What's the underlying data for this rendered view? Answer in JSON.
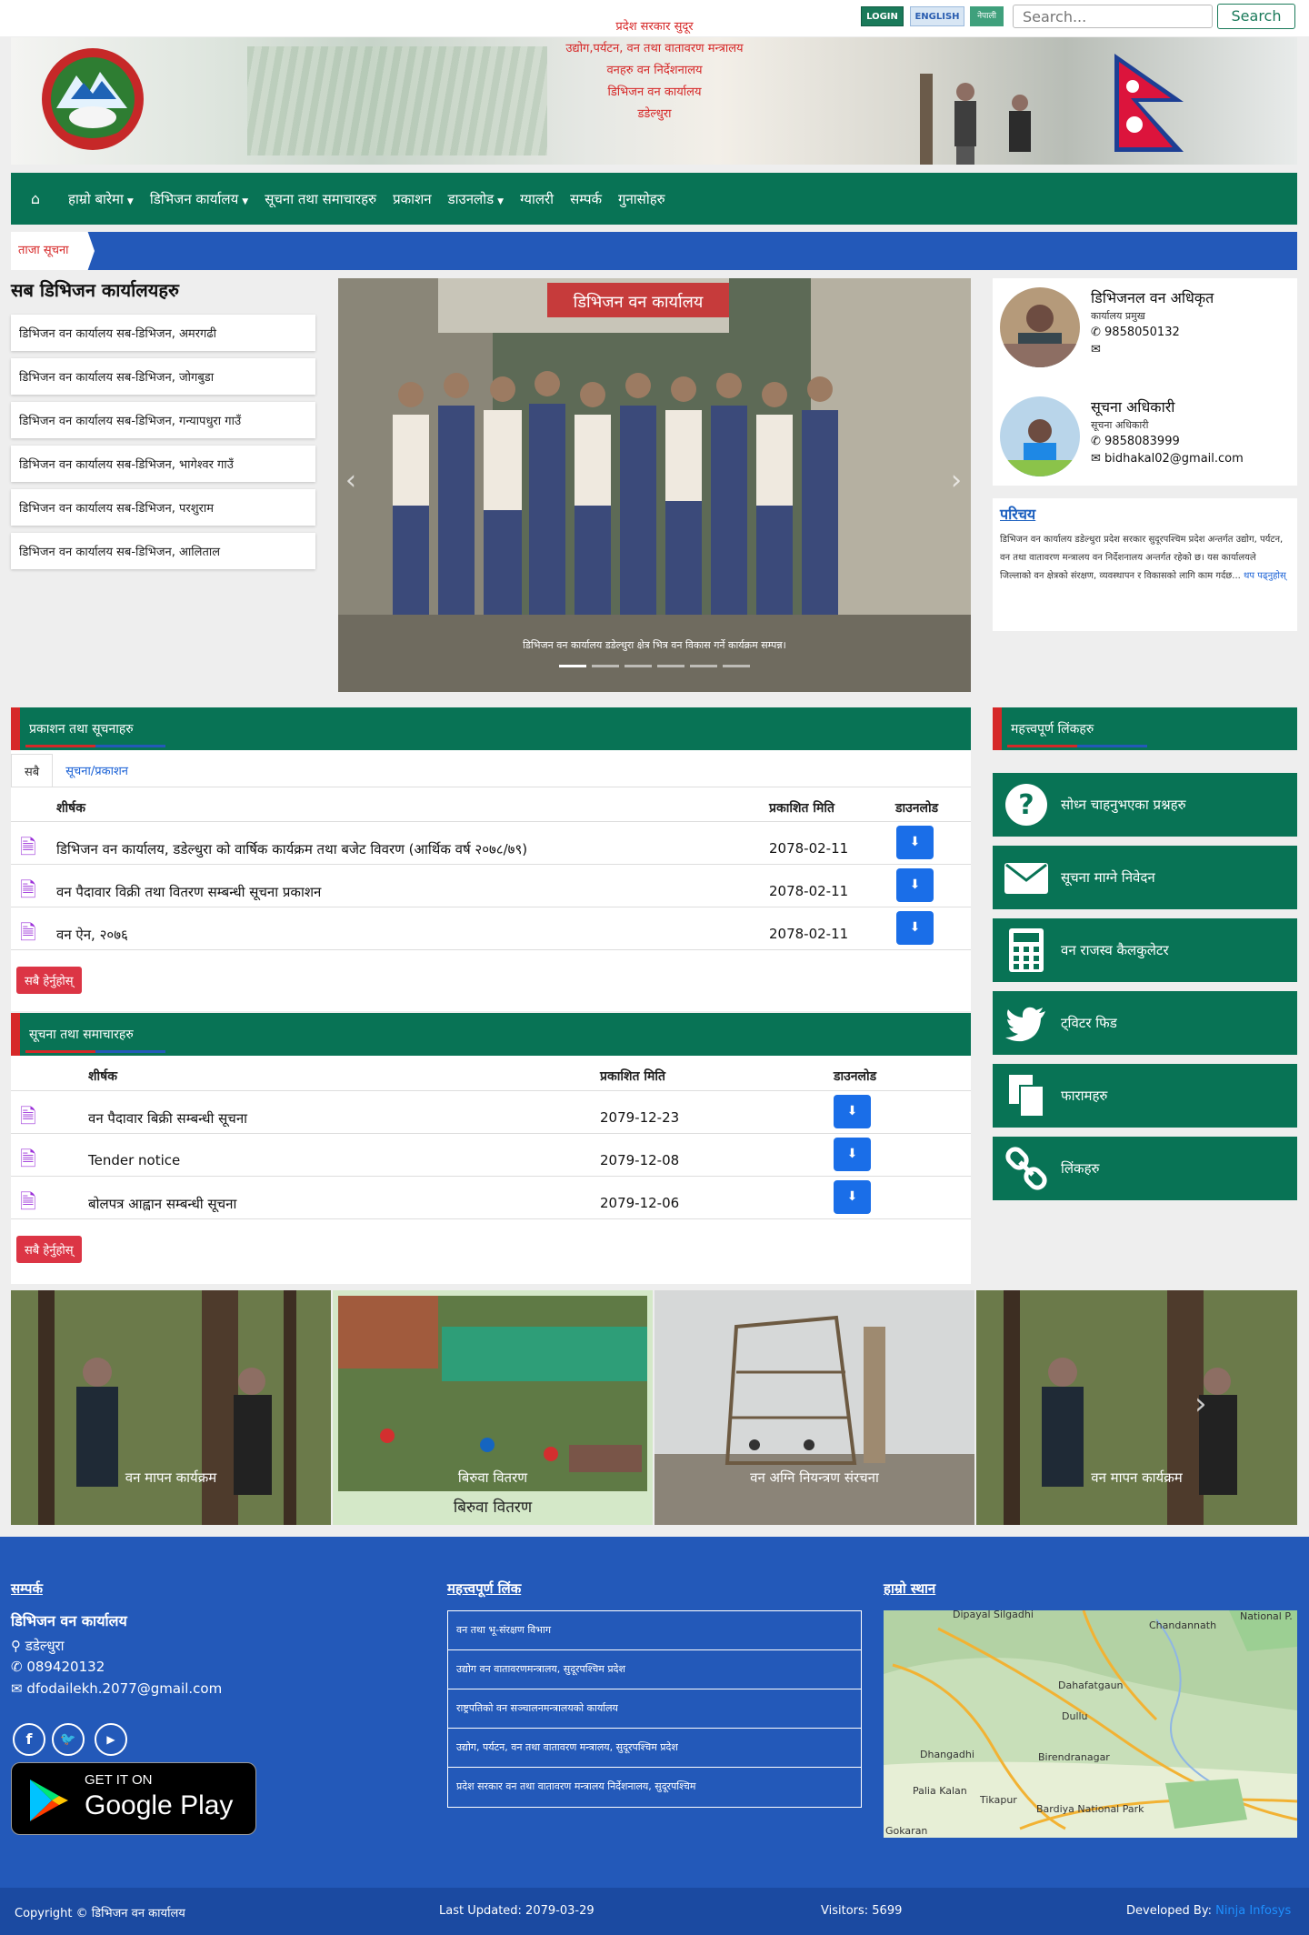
{
  "topbar": {
    "login_label": "LOGIN",
    "english_label": "ENGLISH",
    "nepali_label": "नेपाली",
    "search_placeholder": "Search...",
    "search_button": "Search"
  },
  "banner": {
    "lines": [
      "प्रदेश सरकार सुदूर",
      "उद्योग,पर्यटन, वन तथा वातावरण मन्त्रालय",
      "वनहरु वन निर्देशनालय",
      "डिभिजन वन कार्यालय",
      "डडेल्धुरा"
    ]
  },
  "nav": {
    "home_icon": "home-icon",
    "items": [
      {
        "label": "हाम्रो बारेमा",
        "dropdown": true
      },
      {
        "label": "डिभिजन कार्यालय",
        "dropdown": true
      },
      {
        "label": "सूचना तथा समाचारहरु",
        "dropdown": false
      },
      {
        "label": "प्रकाशन",
        "dropdown": false
      },
      {
        "label": "डाउनलोड",
        "dropdown": true
      },
      {
        "label": "ग्यालरी",
        "dropdown": false
      },
      {
        "label": "सम्पर्क",
        "dropdown": false
      },
      {
        "label": "गुनासोहरु",
        "dropdown": false
      }
    ]
  },
  "ticker": {
    "label": "ताजा सूचना"
  },
  "offices": {
    "title": "सब डिभिजन कार्यालयहरु",
    "items": [
      "डिभिजन वन कार्यालय सब-डिभिजन, अमरगढी",
      "डिभिजन वन कार्यालय सब-डिभिजन, जोगबुडा",
      "डिभिजन वन कार्यालय सब-डिभिजन, गन्यापधुरा गाउँ",
      "डिभिजन वन कार्यालय सब-डिभिजन, भागेश्वर गाउँ",
      "डिभिजन वन कार्यालय सब-डिभिजन, परशुराम",
      "डिभिजन वन कार्यालय सब-डिभिजन, आलिताल"
    ]
  },
  "carousel": {
    "caption": "डिभिजन वन कार्यालय डडेल्धुरा क्षेत्र भित्र वन विकास गर्ने कार्यक्रम सम्पन्न।",
    "slide_count": 6,
    "active_slide": 1,
    "sign_text": "डिभिजन वन कार्यालय"
  },
  "staff": [
    {
      "name": "डिभिजनल वन अधिकृत",
      "role": "कार्यालय प्रमुख",
      "phone": "9858050132",
      "email": ""
    },
    {
      "name": "सूचना अधिकारी",
      "role": "सूचना अधिकारी",
      "phone": "9858083999",
      "email": "bidhakal02@gmail.com"
    }
  ],
  "about": {
    "title": "परिचय",
    "body": "डिभिजन वन कार्यालय डडेल्धुरा प्रदेश सरकार सुदूरपश्चिम प्रदेश अन्तर्गत उद्योग, पर्यटन, वन तथा वातावरण मन्त्रालय वन निर्देशनालय अन्तर्गत रहेको छ। यस कार्यालयले जिल्लाको वन क्षेत्रको संरक्षण, व्यवस्थापन र विकासको लागि काम गर्दछ...",
    "more": "थप पढ्नुहोस्"
  },
  "publications": {
    "title": "प्रकाशन तथा सूचनाहरु",
    "tabs": [
      "सबै",
      "सूचना/प्रकाशन"
    ],
    "headers": {
      "title": "शीर्षक",
      "date": "प्रकाशित मिति",
      "download": "डाउनलोड"
    },
    "rows": [
      {
        "title": "डिभिजन वन कार्यालय, डडेल्धुरा को वार्षिक कार्यक्रम तथा बजेट विवरण (आर्थिक वर्ष २०७८/७९)",
        "date": "2078-02-11"
      },
      {
        "title": "वन पैदावार विक्री तथा वितरण सम्बन्धी सूचना प्रकाशन",
        "date": "2078-02-11"
      },
      {
        "title": "वन ऐन, २०७६",
        "date": "2078-02-11"
      }
    ],
    "all_button": "सबै हेर्नुहोस्"
  },
  "news": {
    "title": "सूचना तथा समाचारहरु",
    "headers": {
      "title": "शीर्षक",
      "date": "प्रकाशित मिति",
      "download": "डाउनलोड"
    },
    "rows": [
      {
        "title": "वन पैदावार बिक्री सम्बन्धी सूचना",
        "date": "2079-12-23"
      },
      {
        "title": "Tender notice",
        "date": "2079-12-08"
      },
      {
        "title": "बोलपत्र आह्वान सम्बन्धी सूचना",
        "date": "2079-12-06"
      }
    ],
    "all_button": "सबै हेर्नुहोस्"
  },
  "important_links": {
    "title": "महत्त्वपूर्ण लिंकहरु",
    "items": [
      {
        "label": "सोध्न चाहनुभएका प्रश्नहरु",
        "icon": "question-circle-icon"
      },
      {
        "label": "सूचना माग्ने निवेदन",
        "icon": "envelope-icon"
      },
      {
        "label": "वन राजस्व कैलकुलेटर",
        "icon": "calculator-icon"
      },
      {
        "label": "ट्विटर फिड",
        "icon": "twitter-icon"
      },
      {
        "label": "फारामहरु",
        "icon": "copy-icon"
      },
      {
        "label": "लिंकहरु",
        "icon": "link-icon"
      }
    ]
  },
  "gallery": [
    {
      "caption": "वन मापन कार्यक्रम"
    },
    {
      "caption": "बिरुवा वितरण",
      "overlay": "बिरुवा वितरण"
    },
    {
      "caption": "वन अग्नि नियन्त्रण संरचना"
    },
    {
      "caption": "वन मापन कार्यक्रम"
    }
  ],
  "footer": {
    "contact_title": "सम्पर्क",
    "org_name": "डिभिजन वन कार्यालय",
    "location": "डडेल्धुरा",
    "phone": "089420132",
    "email": "dfodailekh.2077@gmail.com",
    "links_title": "महत्त्वपूर्ण लिंक",
    "links": [
      "वन तथा भू-संरक्षण विभाग",
      "उद्योग वन वातावरणमन्त्रालय, सुदूरपश्चिम प्रदेश",
      "राष्ट्रपतिको वन सञ्चालनमन्त्रालयको कार्यालय",
      "उद्योग, पर्यटन, वन तथा वातावरण मन्त्रालय, सुदूरपश्चिम प्रदेश",
      "प्रदेश सरकार वन तथा वातावरण मन्त्रालय निर्देशनालय, सुदूरपश्चिम"
    ],
    "map_title": "हाम्रो स्थान",
    "gplay_small": "GET IT ON",
    "gplay_big": "Google Play",
    "map_labels": [
      "Dipayal Silgadhi",
      "Chandannath",
      "National P.",
      "Dahafatgaun",
      "Dullu",
      "Birendranagar",
      "Dhangadhi",
      "Palia Kalan",
      "Tikapur",
      "Bardiya National Park",
      "Gokaran"
    ]
  },
  "bottom": {
    "copyright": "Copyright © डिभिजन वन कार्यालय",
    "updated": "Last Updated: 2079-03-29",
    "visitors": "Visitors: 5699",
    "developed_by_label": "Developed By:",
    "developer": "Ninja Infosys"
  },
  "colors": {
    "primary_green": "#087355",
    "accent_red": "#d62828",
    "blue": "#2359b9",
    "download_blue": "#1a6ee8"
  }
}
